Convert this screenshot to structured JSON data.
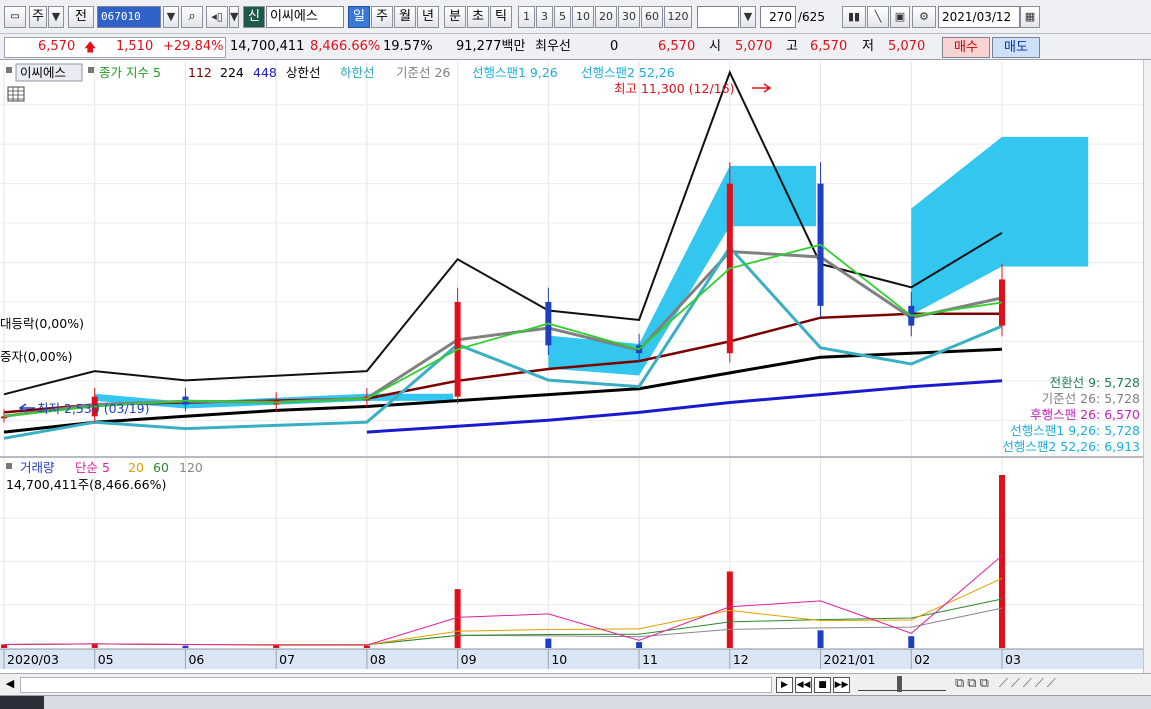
{
  "toolbar": {
    "market": "주",
    "market_btn": "전",
    "code": "067010",
    "credit_badge": "신",
    "name": "이씨에스",
    "periods": [
      "일",
      "주",
      "월",
      "년",
      "분",
      "초",
      "틱"
    ],
    "minute_values": [
      "1",
      "3",
      "5",
      "10",
      "20",
      "30",
      "60",
      "120"
    ],
    "count": "270",
    "count_total": "/625",
    "date": "2021/03/12"
  },
  "quote": {
    "price": "6,570",
    "change": "1,510",
    "change_pct": "+29.84%",
    "volume": "14,700,411",
    "volume_ratio": "8,466.66%",
    "turnover": "19.57%",
    "amount": "91,277백만",
    "best_quote_label": "최우선",
    "best_quote_value": "0",
    "best_quote_price": "6,570",
    "open_label": "시",
    "open": "5,070",
    "high_label": "고",
    "high": "6,570",
    "low_label": "저",
    "low": "5,070",
    "buy": "매수",
    "sell": "매도"
  },
  "price_panel": {
    "legend": {
      "name": "이씨에스",
      "ma_label": "종가 지수 5",
      "ma_periods": [
        "112",
        "224",
        "448"
      ],
      "upper": "상한선",
      "lower": "하한선",
      "base_line": "기준선 26",
      "span1": "선행스팬1 9,26",
      "span2": "선행스팬2 52,26"
    },
    "high_annotation": "최고 11,300 (12/16)",
    "low_annotation": "최저 2,530 (03/19)",
    "left_label_1": "대등락(0,00%)",
    "left_label_2": "증자(0,00%)",
    "indicators": [
      "전환선 9: 5,728",
      "기준선 26: 5,728",
      "후행스팬 26: 6,570",
      "선행스팬1 9,26: 5,728",
      "선행스팬2 52,26: 6,913"
    ]
  },
  "volume_panel": {
    "legend": {
      "title": "거래량",
      "ma_label": "단순 5",
      "ma_periods": [
        "20",
        "60",
        "120"
      ]
    },
    "current": "14,700,411주(8,466.66%)"
  },
  "x_axis": [
    "2020/03",
    "05",
    "06",
    "07",
    "08",
    "09",
    "10",
    "11",
    "12",
    "2021/01",
    "02",
    "03"
  ],
  "colors": {
    "up": "#e0101a",
    "down": "#1f3fc2",
    "cloud": "#33c6ee",
    "ma5": "#2fcf2f",
    "ma112": "#7a0000",
    "ma224": "#000000",
    "ma448": "#1a1acd",
    "upper": "#111111",
    "lower": "#3aafc4",
    "base_line": "#808080",
    "vol_ma5": "#e0209a",
    "vol_ma20": "#e0a000",
    "vol_ma60": "#2a8a2a",
    "vol_ma120": "#888888"
  },
  "chart_data": {
    "type": "candlestick",
    "x": [
      "2020/03",
      "2020/05",
      "2020/06",
      "2020/07",
      "2020/08",
      "2020/09",
      "2020/10",
      "2020/11",
      "2020/12",
      "2021/01",
      "2021/02",
      "2021/03"
    ],
    "series": [
      {
        "name": "종가",
        "values": [
          3100,
          3600,
          3400,
          3500,
          3600,
          6000,
          4900,
          4700,
          9000,
          5900,
          5400,
          6570
        ]
      },
      {
        "name": "112",
        "values": [
          3200,
          3400,
          3450,
          3500,
          3550,
          4000,
          4300,
          4500,
          5000,
          5600,
          5700,
          5700
        ]
      },
      {
        "name": "224",
        "values": [
          2700,
          2950,
          3100,
          3250,
          3350,
          3500,
          3650,
          3800,
          4200,
          4600,
          4700,
          4800
        ]
      },
      {
        "name": "448",
        "values": [
          null,
          null,
          null,
          null,
          2700,
          2850,
          3000,
          3200,
          3450,
          3650,
          3850,
          4000
        ]
      }
    ],
    "volume": {
      "name": "거래량",
      "values": [
        0.3,
        0.4,
        0.2,
        0.3,
        0.2,
        5.0,
        0.8,
        0.5,
        6.5,
        1.5,
        1.0,
        14.7
      ],
      "unit": "백만주"
    },
    "ylim": [
      2500,
      11500
    ]
  }
}
